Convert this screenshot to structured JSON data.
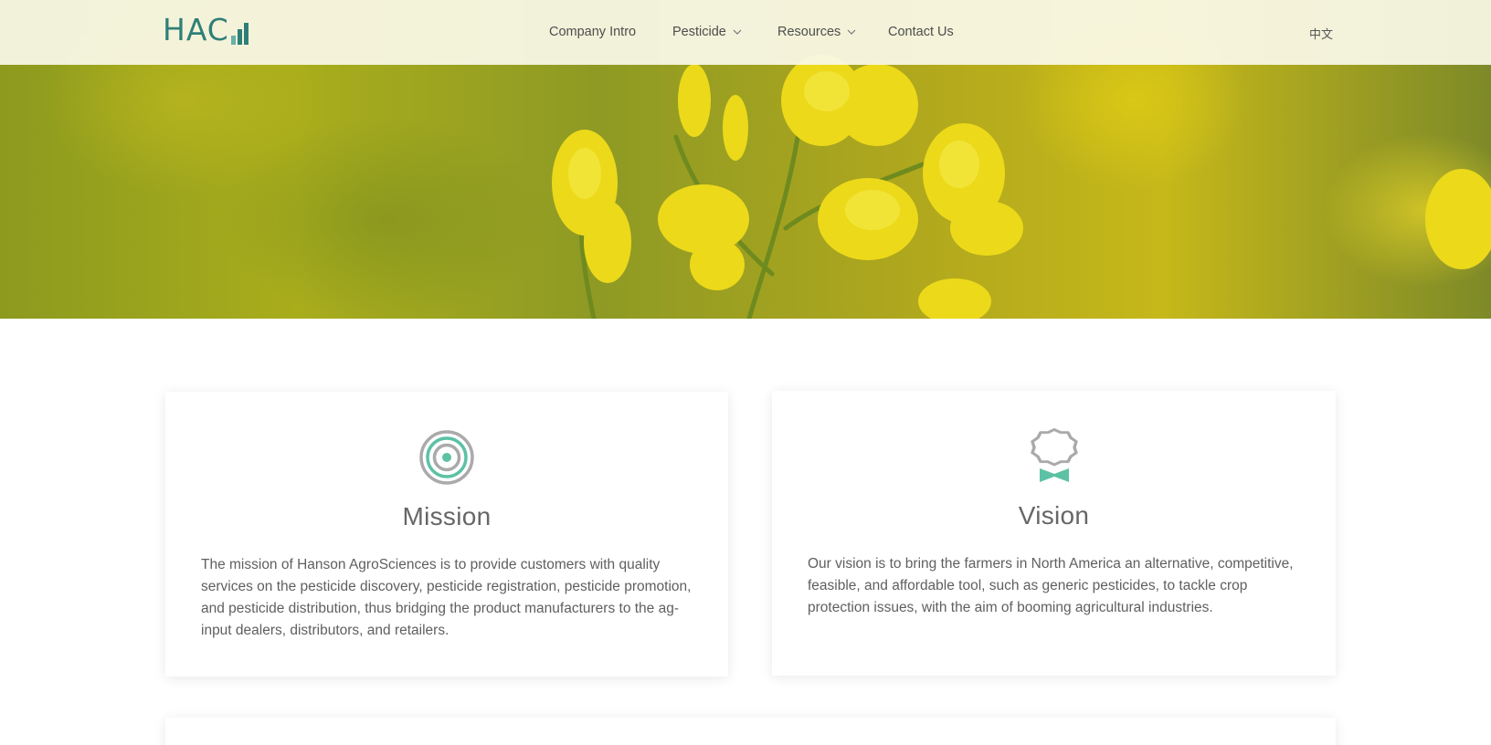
{
  "header": {
    "logo_text": "HAC",
    "nav": [
      {
        "label": "Company Intro",
        "has_dropdown": false
      },
      {
        "label": "Pesticide",
        "has_dropdown": true
      },
      {
        "label": "Resources",
        "has_dropdown": true
      },
      {
        "label": "Contact Us",
        "has_dropdown": false
      }
    ],
    "language_label": "中文"
  },
  "cards": {
    "mission": {
      "icon": "target-icon",
      "title": "Mission",
      "text": "The mission of Hanson AgroSciences is to provide customers with quality services on the pesticide discovery, pesticide registration, pesticide promotion, and pesticide distribution, thus bridging the product manufacturers to the ag-input dealers, distributors, and retailers."
    },
    "vision": {
      "icon": "award-badge-icon",
      "title": "Vision",
      "text": "Our vision is to bring the farmers in North America an alternative, competitive, feasible, and affordable tool, such as generic pesticides, to tackle crop protection issues, with the aim of booming agricultural industries."
    }
  },
  "colors": {
    "brand_teal": "#2f7f78",
    "icon_accent": "#5cc1a5",
    "icon_grey": "#aaaaaa",
    "hero_yellow": "#e8d81e"
  }
}
